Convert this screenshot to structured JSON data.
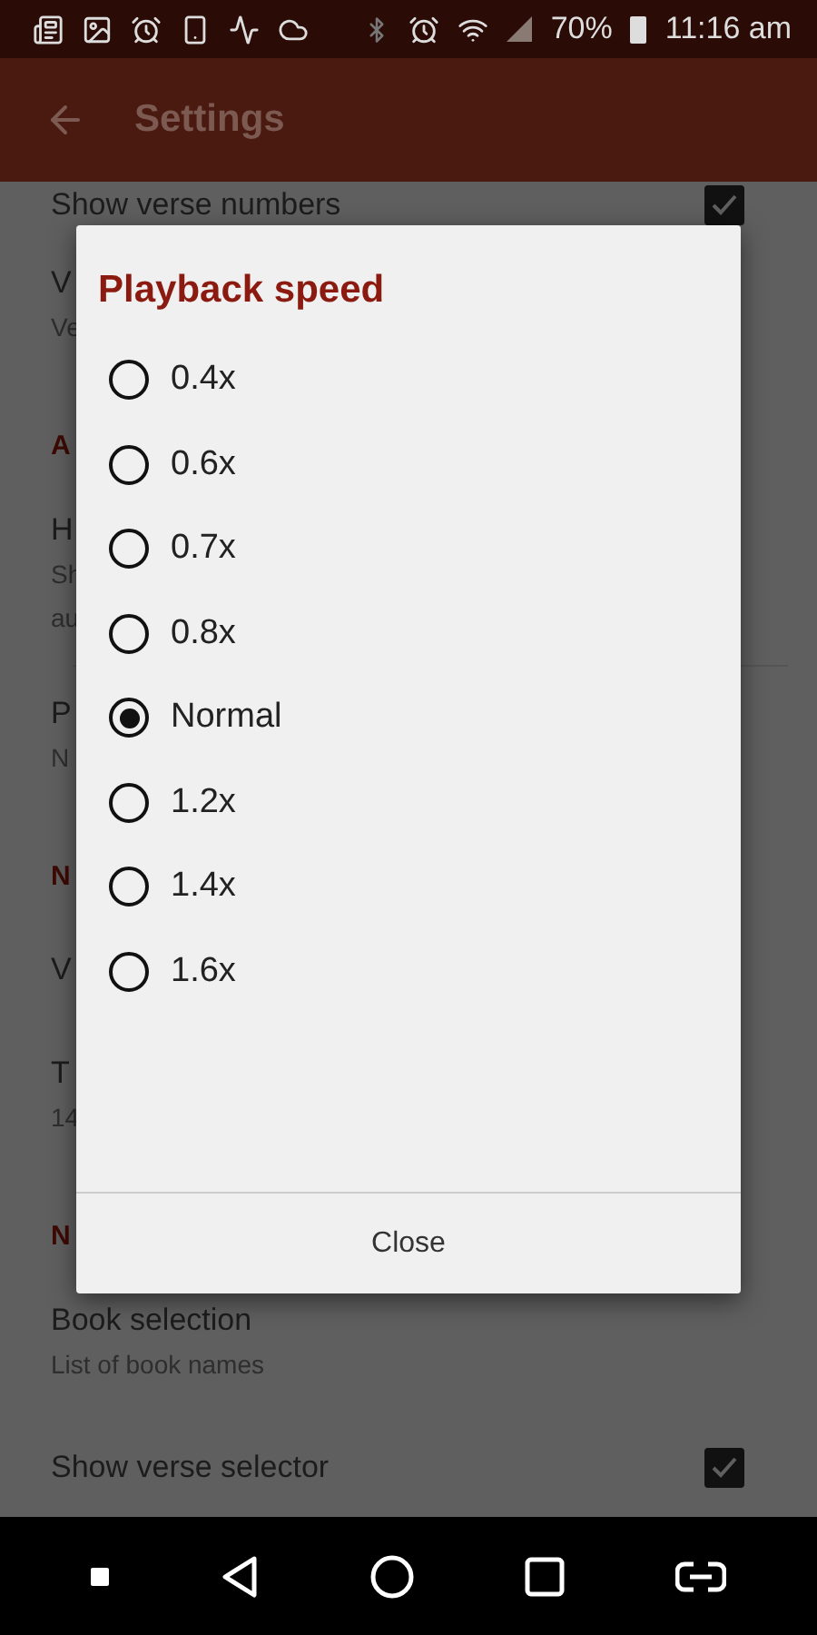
{
  "status_bar": {
    "battery": "70%",
    "time": "11:16 am"
  },
  "app_bar": {
    "title": "Settings"
  },
  "settings": [
    {
      "kind": "item",
      "title": "Show verse numbers",
      "checked": true
    },
    {
      "kind": "item",
      "title": "V",
      "lines": [
        "Ve"
      ]
    },
    {
      "kind": "header",
      "title": "A"
    },
    {
      "kind": "item",
      "title": "H",
      "lines": [
        "Sh",
        "au"
      ]
    },
    {
      "kind": "divider"
    },
    {
      "kind": "item",
      "title": "P",
      "lines": [
        "N"
      ]
    },
    {
      "kind": "header",
      "title": "N"
    },
    {
      "kind": "item",
      "title": "V"
    },
    {
      "kind": "item",
      "title": "T",
      "lines": [
        "14"
      ]
    },
    {
      "kind": "header",
      "title": "N"
    },
    {
      "kind": "item",
      "title": "Book selection",
      "lines": [
        "List of book names"
      ]
    },
    {
      "kind": "item",
      "title": "Show verse selector",
      "checked": true
    }
  ],
  "dialog": {
    "title": "Playback speed",
    "options": [
      {
        "label": "0.4x",
        "selected": false
      },
      {
        "label": "0.6x",
        "selected": false
      },
      {
        "label": "0.7x",
        "selected": false
      },
      {
        "label": "0.8x",
        "selected": false
      },
      {
        "label": "Normal",
        "selected": true
      },
      {
        "label": "1.2x",
        "selected": false
      },
      {
        "label": "1.4x",
        "selected": false
      },
      {
        "label": "1.6x",
        "selected": false
      }
    ],
    "button": "Close"
  }
}
